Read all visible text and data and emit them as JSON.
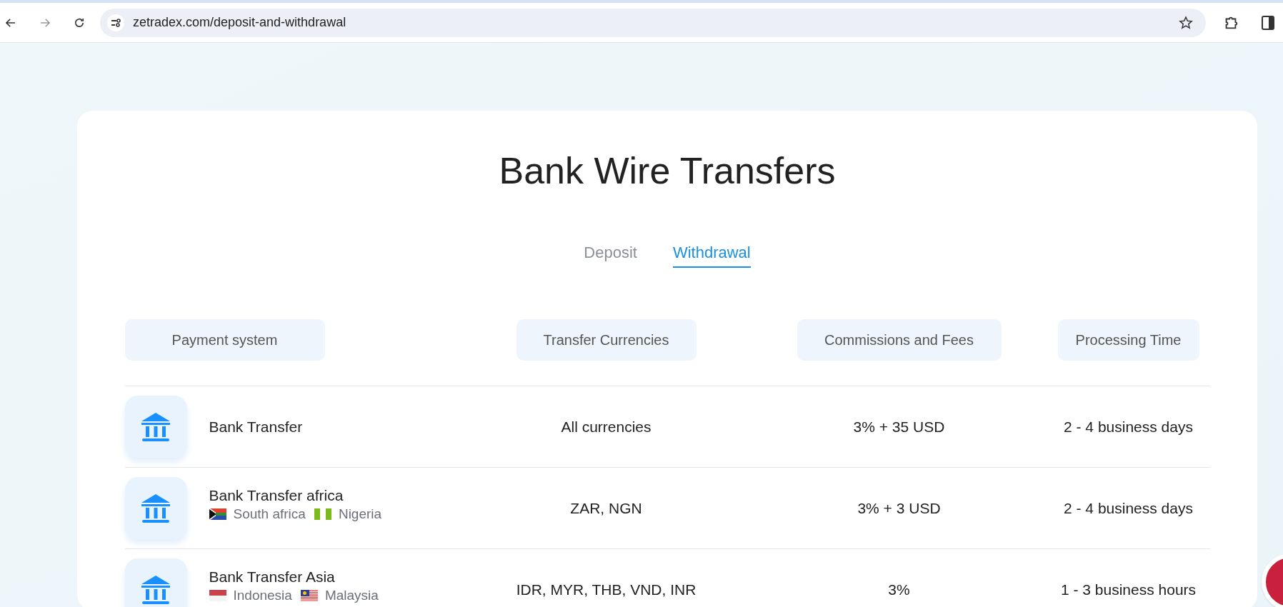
{
  "browser": {
    "url": "zetradex.com/deposit-and-withdrawal"
  },
  "title": "Bank Wire Transfers",
  "tabs": [
    {
      "label": "Deposit",
      "selected": false
    },
    {
      "label": "Withdrawal",
      "selected": true
    }
  ],
  "table": {
    "columns": [
      "Payment system",
      "Transfer Currencies",
      "Commissions and Fees",
      "Processing Time"
    ],
    "rows": [
      {
        "name": "Bank Transfer",
        "countries": [],
        "currencies": "All currencies",
        "fees": "3% + 35 USD",
        "time": "2 - 4 business days"
      },
      {
        "name": "Bank Transfer africa",
        "countries": [
          {
            "kind": "za",
            "label": "South africa"
          },
          {
            "kind": "ng",
            "label": "Nigeria"
          }
        ],
        "currencies": "ZAR, NGN",
        "fees": "3% + 3 USD",
        "time": "2 - 4 business days"
      },
      {
        "name": "Bank Transfer Asia",
        "countries": [
          {
            "kind": "id",
            "label": "Indonesia"
          },
          {
            "kind": "my",
            "label": "Malaysia"
          }
        ],
        "currencies": "IDR, MYR, THB, VND, INR",
        "fees": "3%",
        "time": "1 - 3 business hours"
      }
    ]
  }
}
